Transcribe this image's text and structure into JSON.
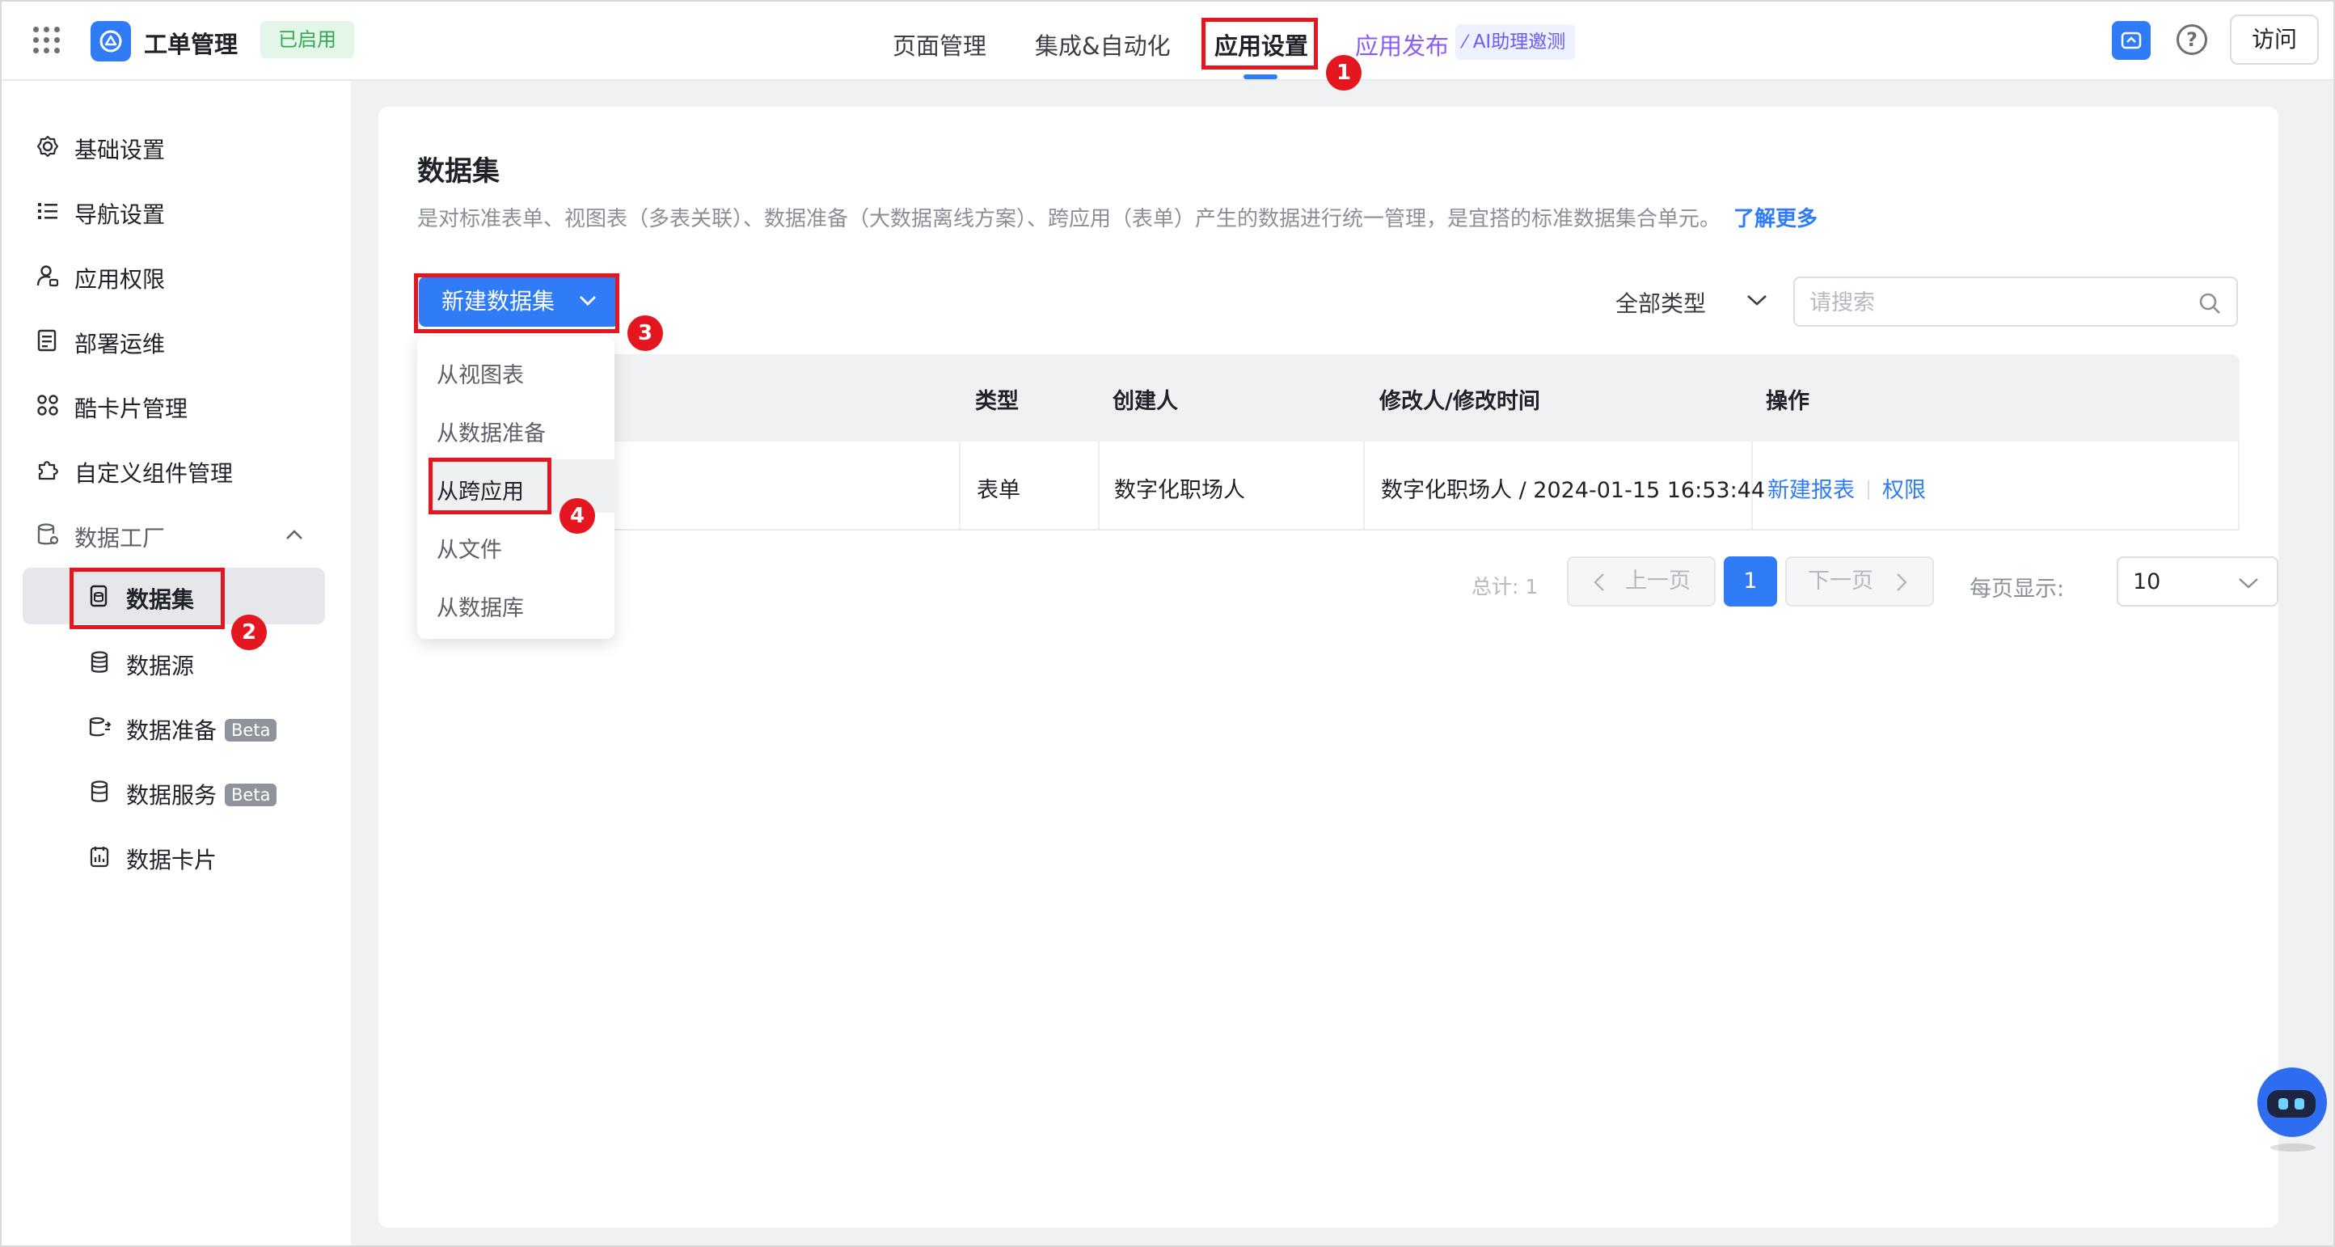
{
  "header": {
    "app_title": "工单管理",
    "status_badge": "已启用",
    "tabs": [
      {
        "label": "页面管理"
      },
      {
        "label": "集成&自动化"
      },
      {
        "label": "应用设置"
      }
    ],
    "publish_label": "应用发布",
    "ai_badge": "AI助理邀测",
    "help_glyph": "?",
    "visit_label": "访问"
  },
  "sidebar": {
    "items": [
      {
        "label": "基础设置",
        "icon": "gear-icon"
      },
      {
        "label": "导航设置",
        "icon": "list-icon"
      },
      {
        "label": "应用权限",
        "icon": "user-lock-icon"
      },
      {
        "label": "部署运维",
        "icon": "document-icon"
      },
      {
        "label": "酷卡片管理",
        "icon": "grid-icon"
      },
      {
        "label": "自定义组件管理",
        "icon": "puzzle-icon"
      },
      {
        "label": "数据工厂",
        "icon": "database-gear-icon"
      }
    ],
    "sub_items": [
      {
        "label": "数据集",
        "icon": "dataset-icon"
      },
      {
        "label": "数据源",
        "icon": "database-icon"
      },
      {
        "label": "数据准备",
        "icon": "data-prep-icon",
        "badge": "Beta"
      },
      {
        "label": "数据服务",
        "icon": "data-service-icon",
        "badge": "Beta"
      },
      {
        "label": "数据卡片",
        "icon": "data-card-icon"
      }
    ]
  },
  "main": {
    "title": "数据集",
    "description": "是对标准表单、视图表（多表关联）、数据准备（大数据离线方案）、跨应用（表单）产生的数据进行统一管理，是宜搭的标准数据集合单元。",
    "learn_more": "了解更多",
    "new_button": "新建数据集",
    "type_filter": "全部类型",
    "search_placeholder": "请搜索",
    "table": {
      "columns": [
        "类型",
        "创建人",
        "修改人/修改时间",
        "操作"
      ],
      "rows": [
        {
          "type": "表单",
          "creator": "数字化职场人",
          "modified": "数字化职场人 / 2024-01-15 16:53:44",
          "action_new_report": "新建报表",
          "action_permission": "权限"
        }
      ]
    },
    "pagination": {
      "total": "总计: 1",
      "prev": "上一页",
      "current": "1",
      "next": "下一页",
      "per_page_label": "每页显示:",
      "per_page_value": "10"
    },
    "dropdown": {
      "items": [
        "从视图表",
        "从数据准备",
        "从跨应用",
        "从文件",
        "从数据库"
      ]
    }
  },
  "annotations": [
    "1",
    "2",
    "3",
    "4"
  ],
  "colors": {
    "accent": "#2f7cf6",
    "annotation_red": "#e4161f",
    "enabled_green": "#33a853",
    "publish_purple": "#8a5cf6"
  }
}
